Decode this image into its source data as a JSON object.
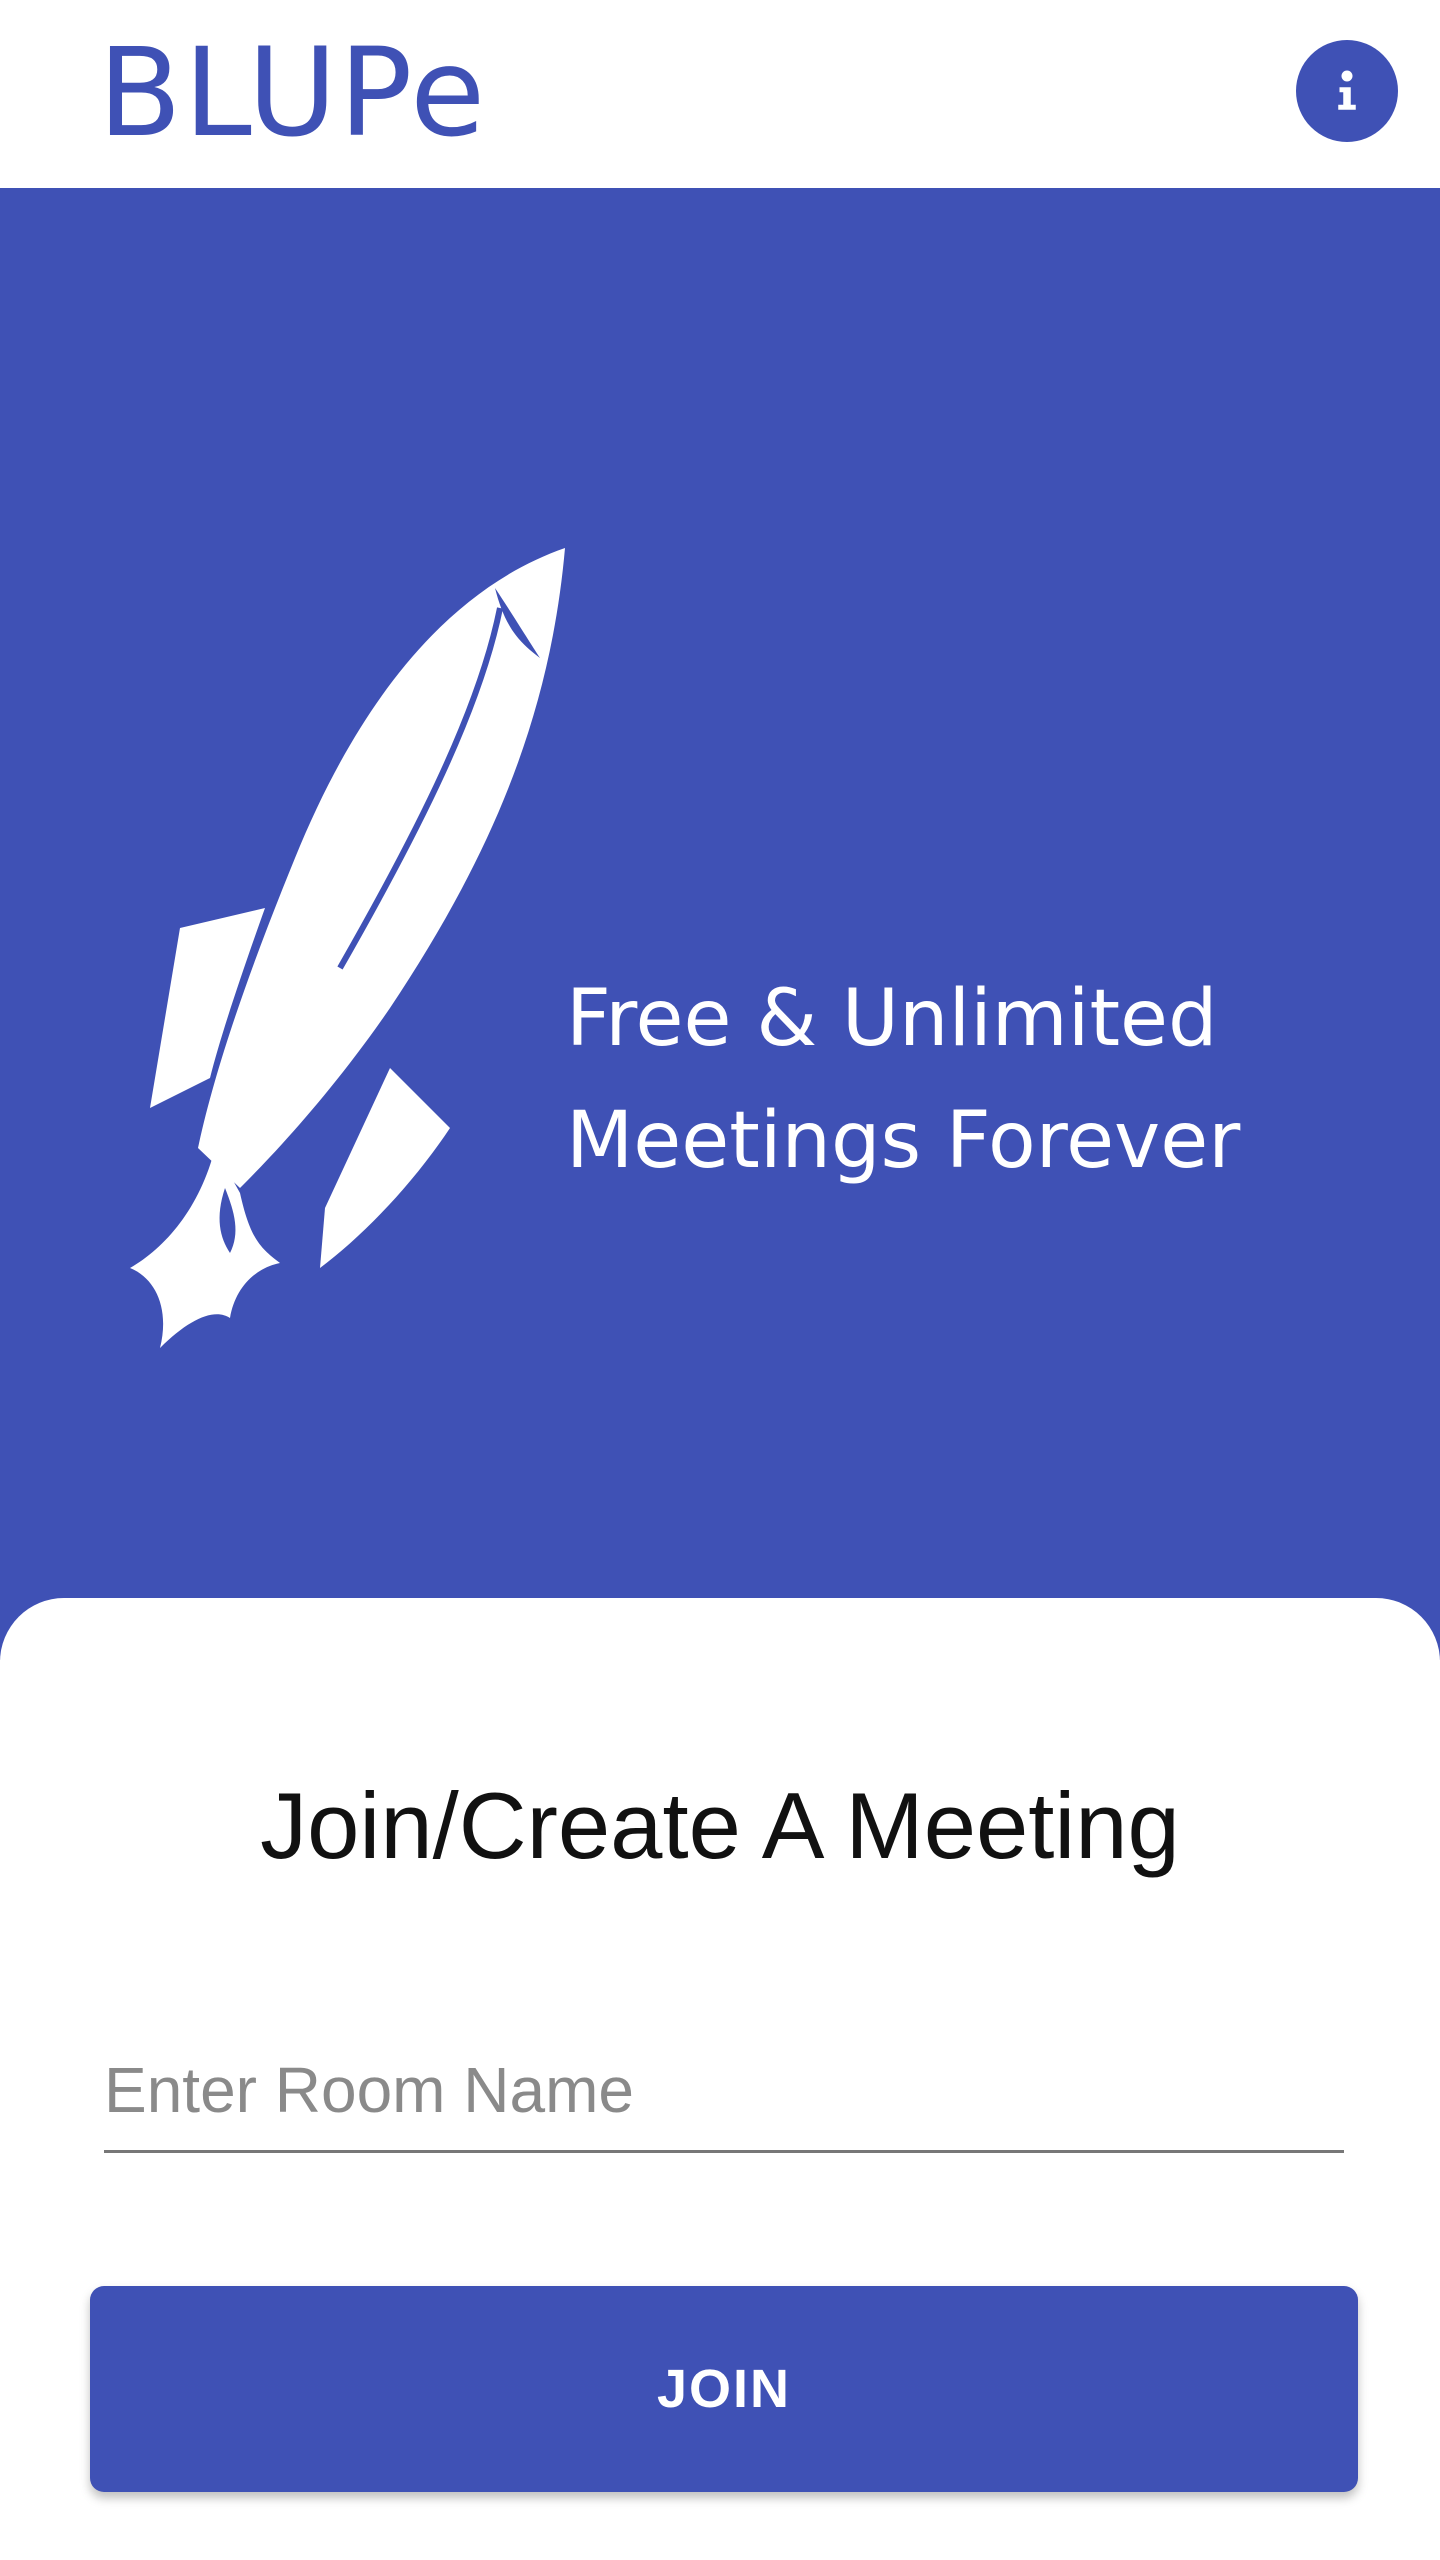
{
  "app": {
    "logo_text": "BLUPe",
    "info_icon": "info-icon"
  },
  "hero": {
    "tagline_line1": "Free & Unlimited",
    "tagline_line2": "Meetings Forever",
    "illustration": "rocket-icon"
  },
  "join": {
    "title": "Join/Create A Meeting",
    "room_input_value": "",
    "room_input_placeholder": "Enter Room Name",
    "join_button_label": "JOIN"
  },
  "colors": {
    "brand": "#3f51b5",
    "background": "#ffffff"
  }
}
